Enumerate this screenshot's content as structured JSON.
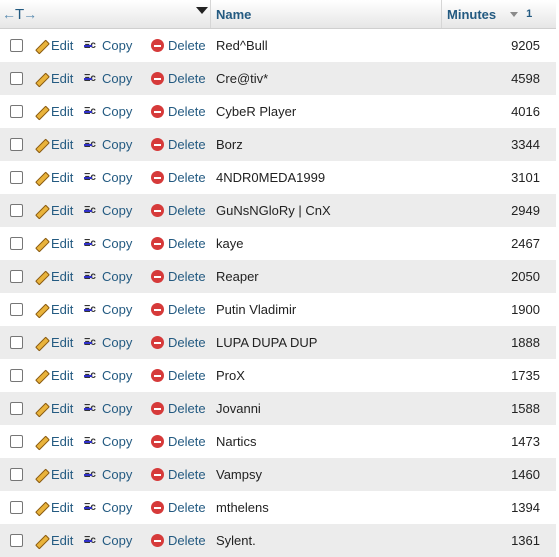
{
  "header": {
    "arrows_left": "←",
    "arrows_t": "T",
    "arrows_right": "→",
    "name_label": "Name",
    "minutes_label": "Minutes",
    "sort_number": "1"
  },
  "actions": {
    "edit": "Edit",
    "copy": "Copy",
    "delete": "Delete"
  },
  "rows": [
    {
      "name": "Red^Bull",
      "minutes": "9205"
    },
    {
      "name": "Cre@tiv*",
      "minutes": "4598"
    },
    {
      "name": "CybeR Player",
      "minutes": "4016"
    },
    {
      "name": "Borz",
      "minutes": "3344"
    },
    {
      "name": "4NDR0MEDA1999",
      "minutes": "3101"
    },
    {
      "name": "GuNsNGloRy | CnX",
      "minutes": "2949"
    },
    {
      "name": "kaye",
      "minutes": "2467"
    },
    {
      "name": "Reaper",
      "minutes": "2050"
    },
    {
      "name": "Putin Vladimir",
      "minutes": "1900"
    },
    {
      "name": "LUPA DUPA DUP",
      "minutes": "1888"
    },
    {
      "name": "ProX",
      "minutes": "1735"
    },
    {
      "name": "Jovanni",
      "minutes": "1588"
    },
    {
      "name": "Nartics",
      "minutes": "1473"
    },
    {
      "name": "Vampsy",
      "minutes": "1460"
    },
    {
      "name": "mthelens",
      "minutes": "1394"
    },
    {
      "name": "Sylent.",
      "minutes": "1361"
    }
  ]
}
